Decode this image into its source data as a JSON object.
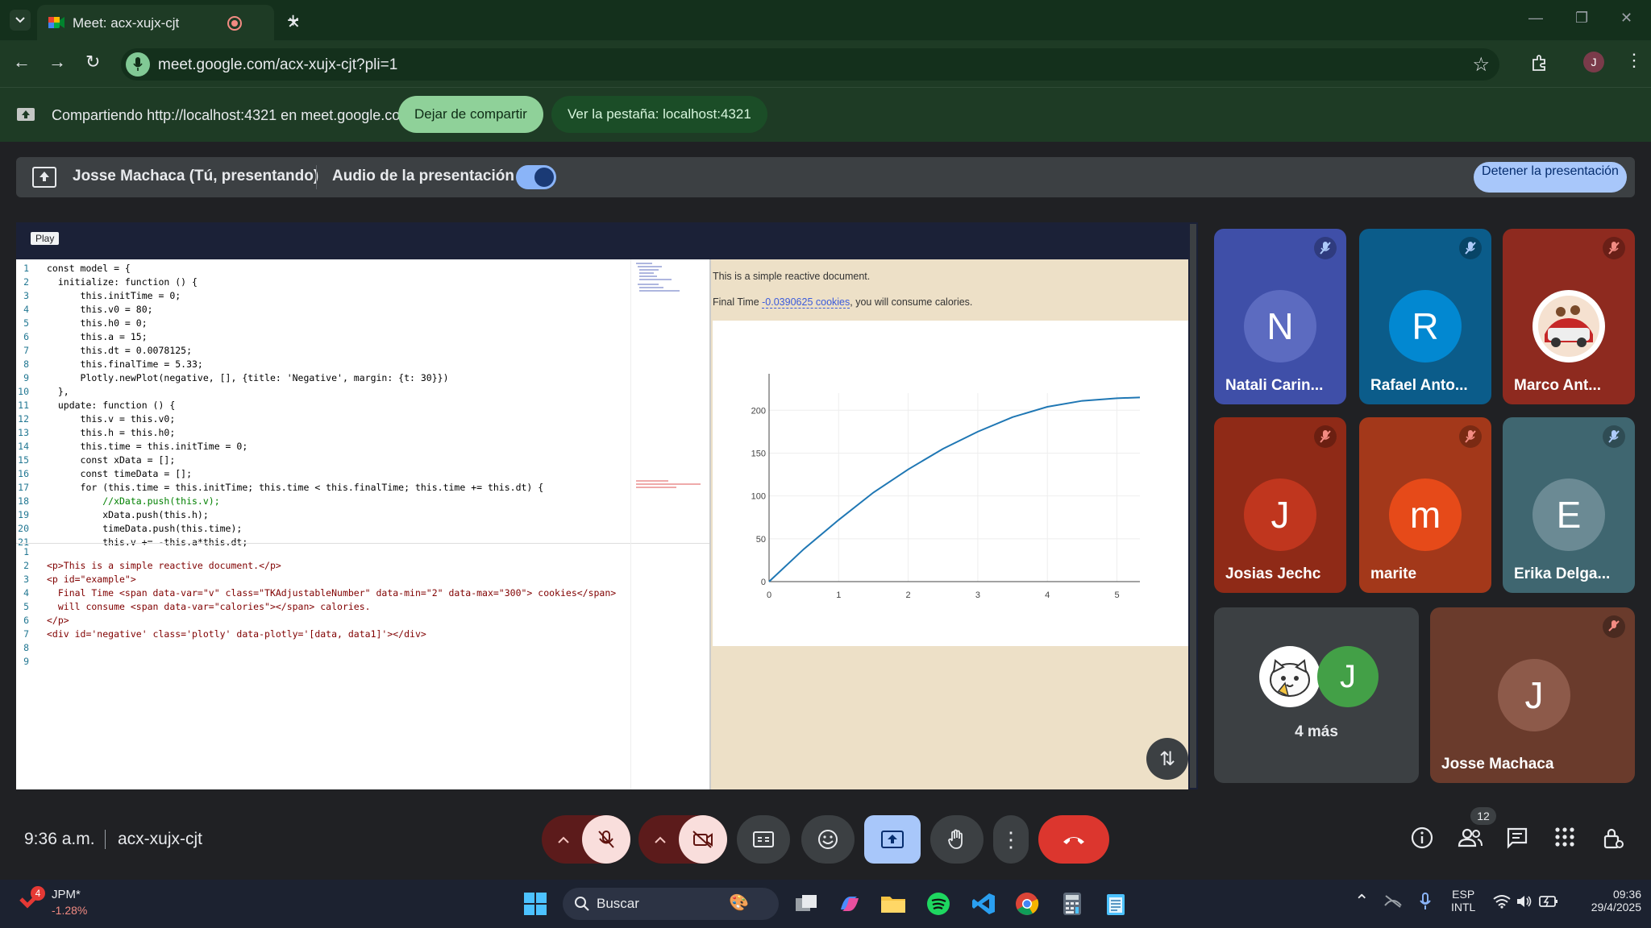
{
  "browser": {
    "tab_title": "Meet: acx-xujx-cjt",
    "url": "meet.google.com/acx-xujx-cjt?pli=1",
    "profile_initial": "J"
  },
  "share_banner": {
    "text": "Compartiendo http://localhost:4321 en meet.google.com",
    "stop_sharing": "Dejar de compartir",
    "view_tab": "Ver la pestaña: localhost:4321"
  },
  "presenter_bar": {
    "presenter": "Josse Machaca (Tú, presentando)",
    "audio_label": "Audio de la presentación",
    "stop_presenting": "Detener la presentación"
  },
  "shared_screen": {
    "play_label": "Play",
    "output_line1": "This is a simple reactive document.",
    "output_line2_prefix": "Final Time ",
    "output_value": "-0.0390625 cookies",
    "output_line2_suffix": ", you will consume calories."
  },
  "chart_data": {
    "type": "line",
    "title": "",
    "xlabel": "",
    "ylabel": "",
    "xlim": [
      0,
      5.33
    ],
    "ylim": [
      0,
      220
    ],
    "x_ticks": [
      "0",
      "1",
      "2",
      "3",
      "4",
      "5"
    ],
    "y_ticks": [
      "0",
      "50",
      "100",
      "150",
      "200"
    ],
    "series": [
      {
        "x": [
          0,
          0.5,
          1,
          1.5,
          2,
          2.5,
          3,
          3.5,
          4,
          4.5,
          5,
          5.33
        ],
        "y": [
          0,
          38,
          72,
          104,
          131,
          155,
          175,
          192,
          204,
          211,
          214,
          215
        ]
      }
    ],
    "color": "#1f77b4",
    "grid": true
  },
  "participants": [
    {
      "initial": "N",
      "name": "Natali Carin...",
      "color": "#5c6bc0",
      "bg": "#3f4fa8"
    },
    {
      "initial": "R",
      "name": "Rafael Anto...",
      "color": "#0288d1",
      "bg": "#0b5c8a"
    },
    {
      "initial": "",
      "name": "Marco Ant...",
      "color": "#c62828",
      "bg": "#8e2a1f"
    },
    {
      "initial": "J",
      "name": "Josias Jechc",
      "color": "#c0361e",
      "bg": "#8f2a17"
    },
    {
      "initial": "m",
      "name": "marite",
      "color": "#e64a19",
      "bg": "#a3381a"
    },
    {
      "initial": "E",
      "name": "Erika Delga...",
      "color": "#6b8a94",
      "bg": "#3f6670"
    }
  ],
  "more_tile": {
    "label": "4 más",
    "initial": "J"
  },
  "self_tile": {
    "initial": "J",
    "name": "Josse Machaca"
  },
  "bottom_bar": {
    "time": "9:36 a.m.",
    "meeting_code": "acx-xujx-cjt",
    "participant_count": "12"
  },
  "taskbar": {
    "stock_name": "JPM*",
    "stock_change": "-1.28%",
    "stock_badge": "4",
    "search": "Buscar",
    "lang1": "ESP",
    "lang2": "INTL",
    "time": "09:36",
    "date": "29/4/2025"
  },
  "code": {
    "js": [
      "const model = {",
      "  initialize: function () {",
      "      this.initTime = 0;",
      "      this.v0 = 80;",
      "      this.h0 = 0;",
      "      this.a = 15;",
      "      this.dt = 0.0078125;",
      "      this.finalTime = 5.33;",
      "      Plotly.newPlot(negative, [], {title: 'Negative', margin: {t: 30}})",
      "  },",
      "  update: function () {",
      "      this.v = this.v0;",
      "      this.h = this.h0;",
      "      this.time = this.initTime = 0;",
      "      const xData = [];",
      "      const timeData = [];",
      "      for (this.time = this.initTime; this.time < this.finalTime; this.time += this.dt) {",
      "          //xData.push(this.v);",
      "          xData.push(this.h);",
      "          timeData.push(this.time);",
      "          this.v += -this.a*this.dt;"
    ],
    "html": [
      "",
      "<p>This is a simple reactive document.</p>",
      "<p id=\"example\">",
      "  Final Time <span data-var=\"v\" class=\"TKAdjustableNumber\" data-min=\"2\" data-max=\"300\"> cookies</span>",
      "  will consume <span data-var=\"calories\"></span> calories.",
      "</p>",
      "<div id='negative' class='plotly' data-plotly='[data, data1]'></div>",
      "",
      ""
    ]
  }
}
